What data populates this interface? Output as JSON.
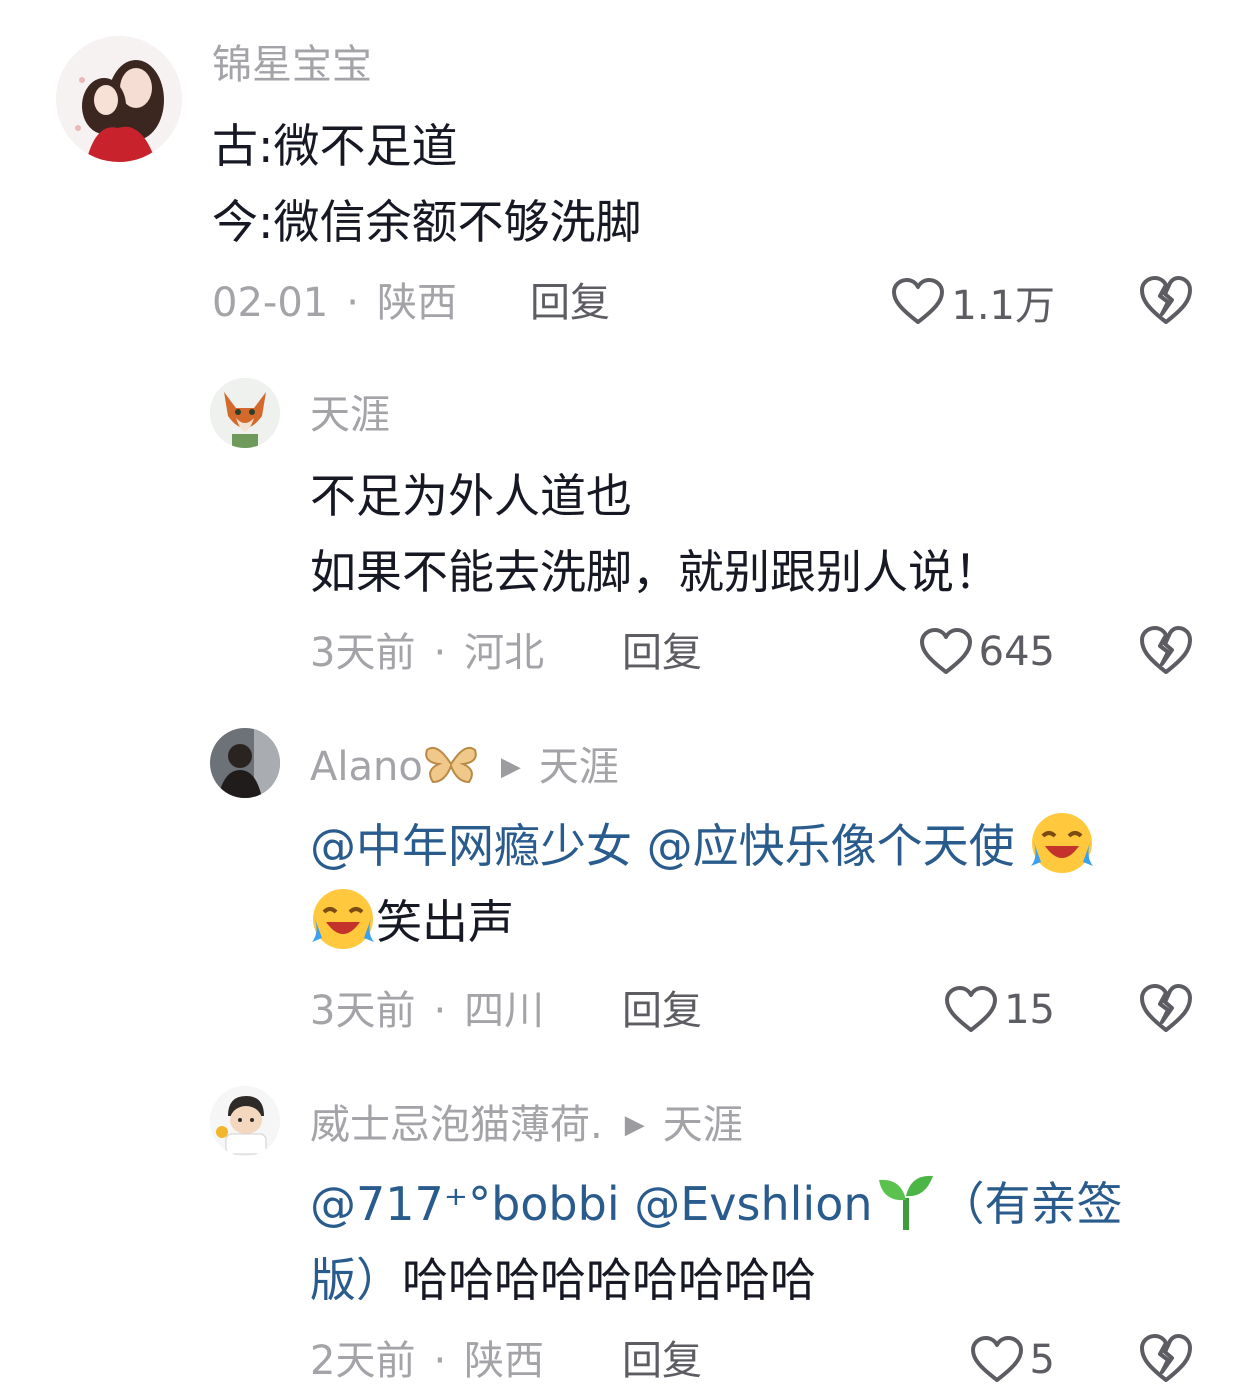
{
  "comments": [
    {
      "username": "锦星宝宝",
      "lines": [
        "古:微不足道",
        "今:微信余额不够洗脚"
      ],
      "time": "02-01",
      "location": "陕西",
      "reply_label": "回复",
      "likes": "1.1万",
      "avatar_icon": "girls-avatar-icon"
    },
    {
      "username": "天涯",
      "lines": [
        "不足为外人道也",
        "如果不能去洗脚，就别跟别人说！"
      ],
      "time": "3天前",
      "location": "河北",
      "reply_label": "回复",
      "likes": "645",
      "avatar_icon": "fox-avatar-icon"
    },
    {
      "username": "Alano",
      "reply_to": "天涯",
      "mentions": [
        "@中年网瘾少女",
        "@应快乐像个天使"
      ],
      "line2_text": "笑出声",
      "time": "3天前",
      "location": "四川",
      "reply_label": "回复",
      "likes": "15",
      "avatar_icon": "person-avatar-icon",
      "name_emoji": "butterfly-icon",
      "inline_emoji": "laughing-crying-icon"
    },
    {
      "username": "威士忌泡猫薄荷.",
      "reply_to": "天涯",
      "mentions": [
        "@717⁺°bobbi",
        "@Evshlion"
      ],
      "line1_tail": "（有亲签",
      "line2_head": "版）",
      "line2_text": "哈哈哈哈哈哈哈哈哈",
      "time": "2天前",
      "location": "陕西",
      "reply_label": "回复",
      "likes": "5",
      "avatar_icon": "cartoon-boy-avatar-icon",
      "inline_emoji": "seedling-icon"
    }
  ],
  "colors": {
    "text": "#161823",
    "muted": "#a3a3a8",
    "action": "#5c5c63",
    "mention": "#2a5b8d"
  }
}
